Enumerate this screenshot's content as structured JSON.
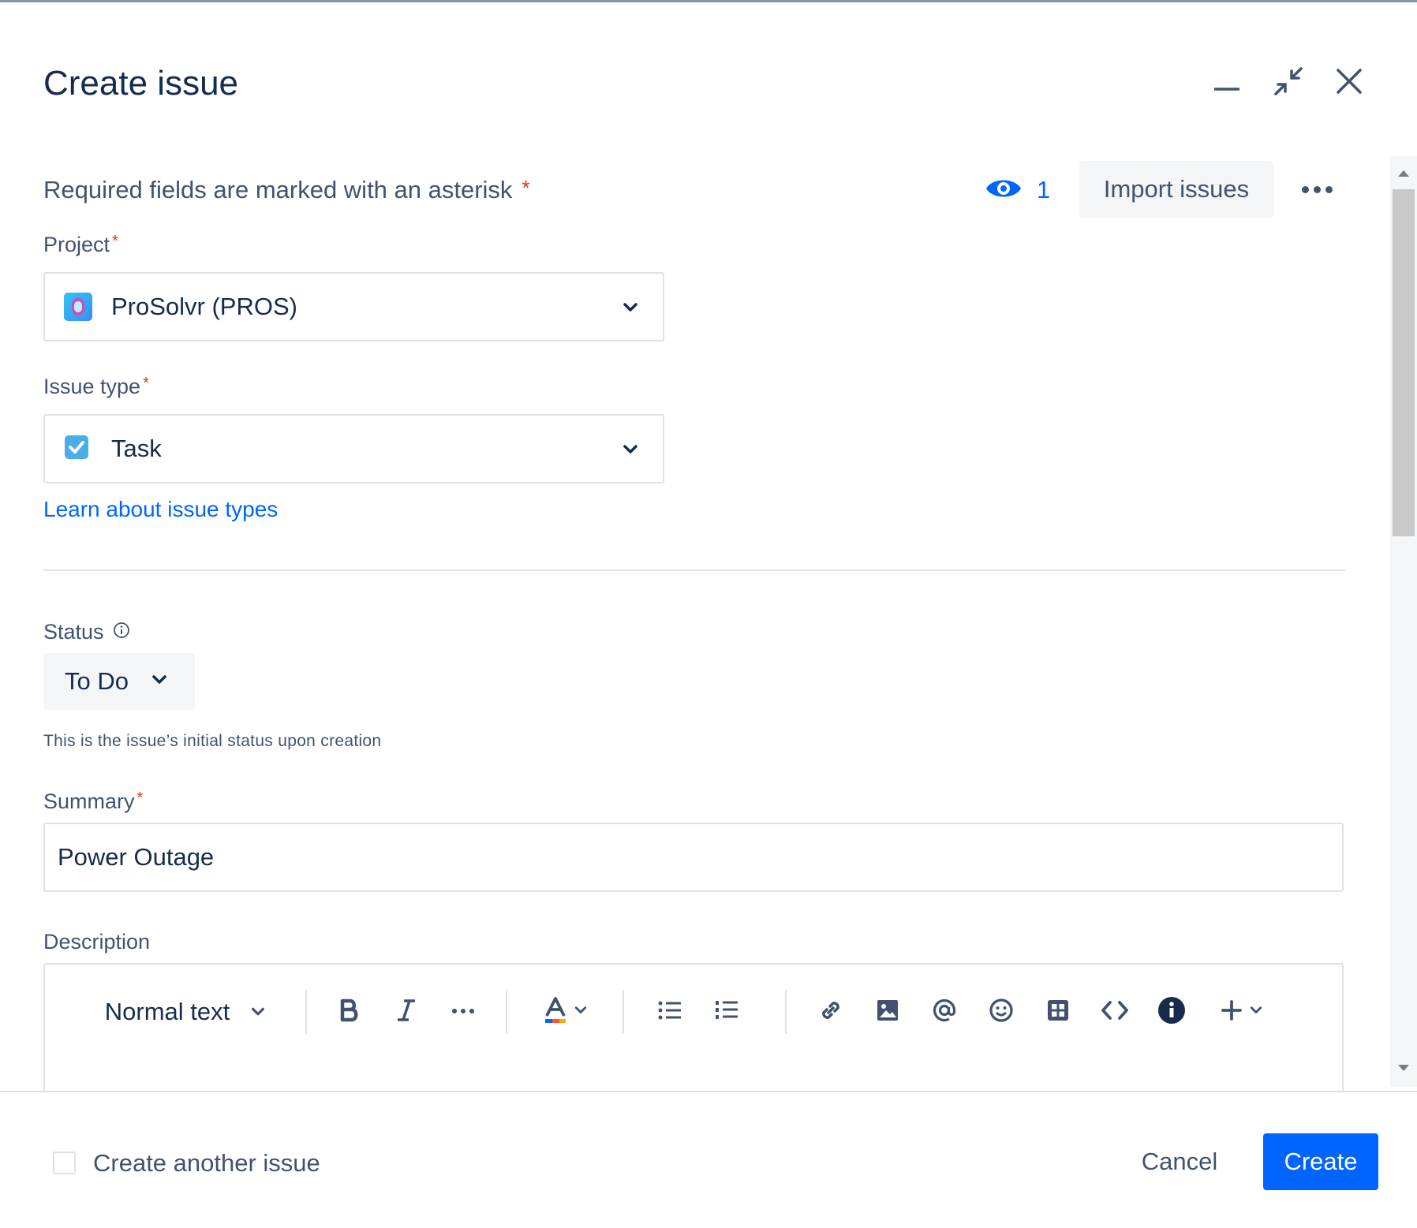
{
  "dialog": {
    "title": "Create issue",
    "controls": {
      "minimize_icon": "minimize-icon",
      "collapse_icon": "collapse-icon",
      "close_icon": "close-icon"
    }
  },
  "form": {
    "required_note": "Required fields are marked with an asterisk",
    "required_star": "*",
    "watchers": {
      "icon": "eye-icon",
      "count": "1"
    },
    "import_label": "Import issues",
    "more_icon": "more-icon",
    "project": {
      "label": "Project",
      "value": "ProSolvr (PROS)"
    },
    "issue_type": {
      "label": "Issue type",
      "value": "Task"
    },
    "learn_link": "Learn about issue types",
    "status": {
      "label": "Status",
      "value": "To Do",
      "help": "This is the issue’s initial status upon creation"
    },
    "summary": {
      "label": "Summary",
      "value": "Power Outage"
    },
    "description": {
      "label": "Description",
      "toolbar": {
        "text_style": "Normal text",
        "icons": [
          "bold-icon",
          "italic-icon",
          "more-formatting-icon",
          "text-color-icon",
          "bullet-list-icon",
          "numbered-list-icon",
          "link-icon",
          "image-icon",
          "mention-icon",
          "emoji-icon",
          "table-icon",
          "code-icon",
          "info-panel-icon",
          "insert-plus-icon"
        ]
      }
    }
  },
  "footer": {
    "create_another": "Create another issue",
    "cancel": "Cancel",
    "create": "Create"
  },
  "colors": {
    "primary": "#0065ff",
    "text": "#172b4d",
    "subtle_text": "#42526e",
    "required": "#de350b",
    "border": "#dfe1e6"
  }
}
